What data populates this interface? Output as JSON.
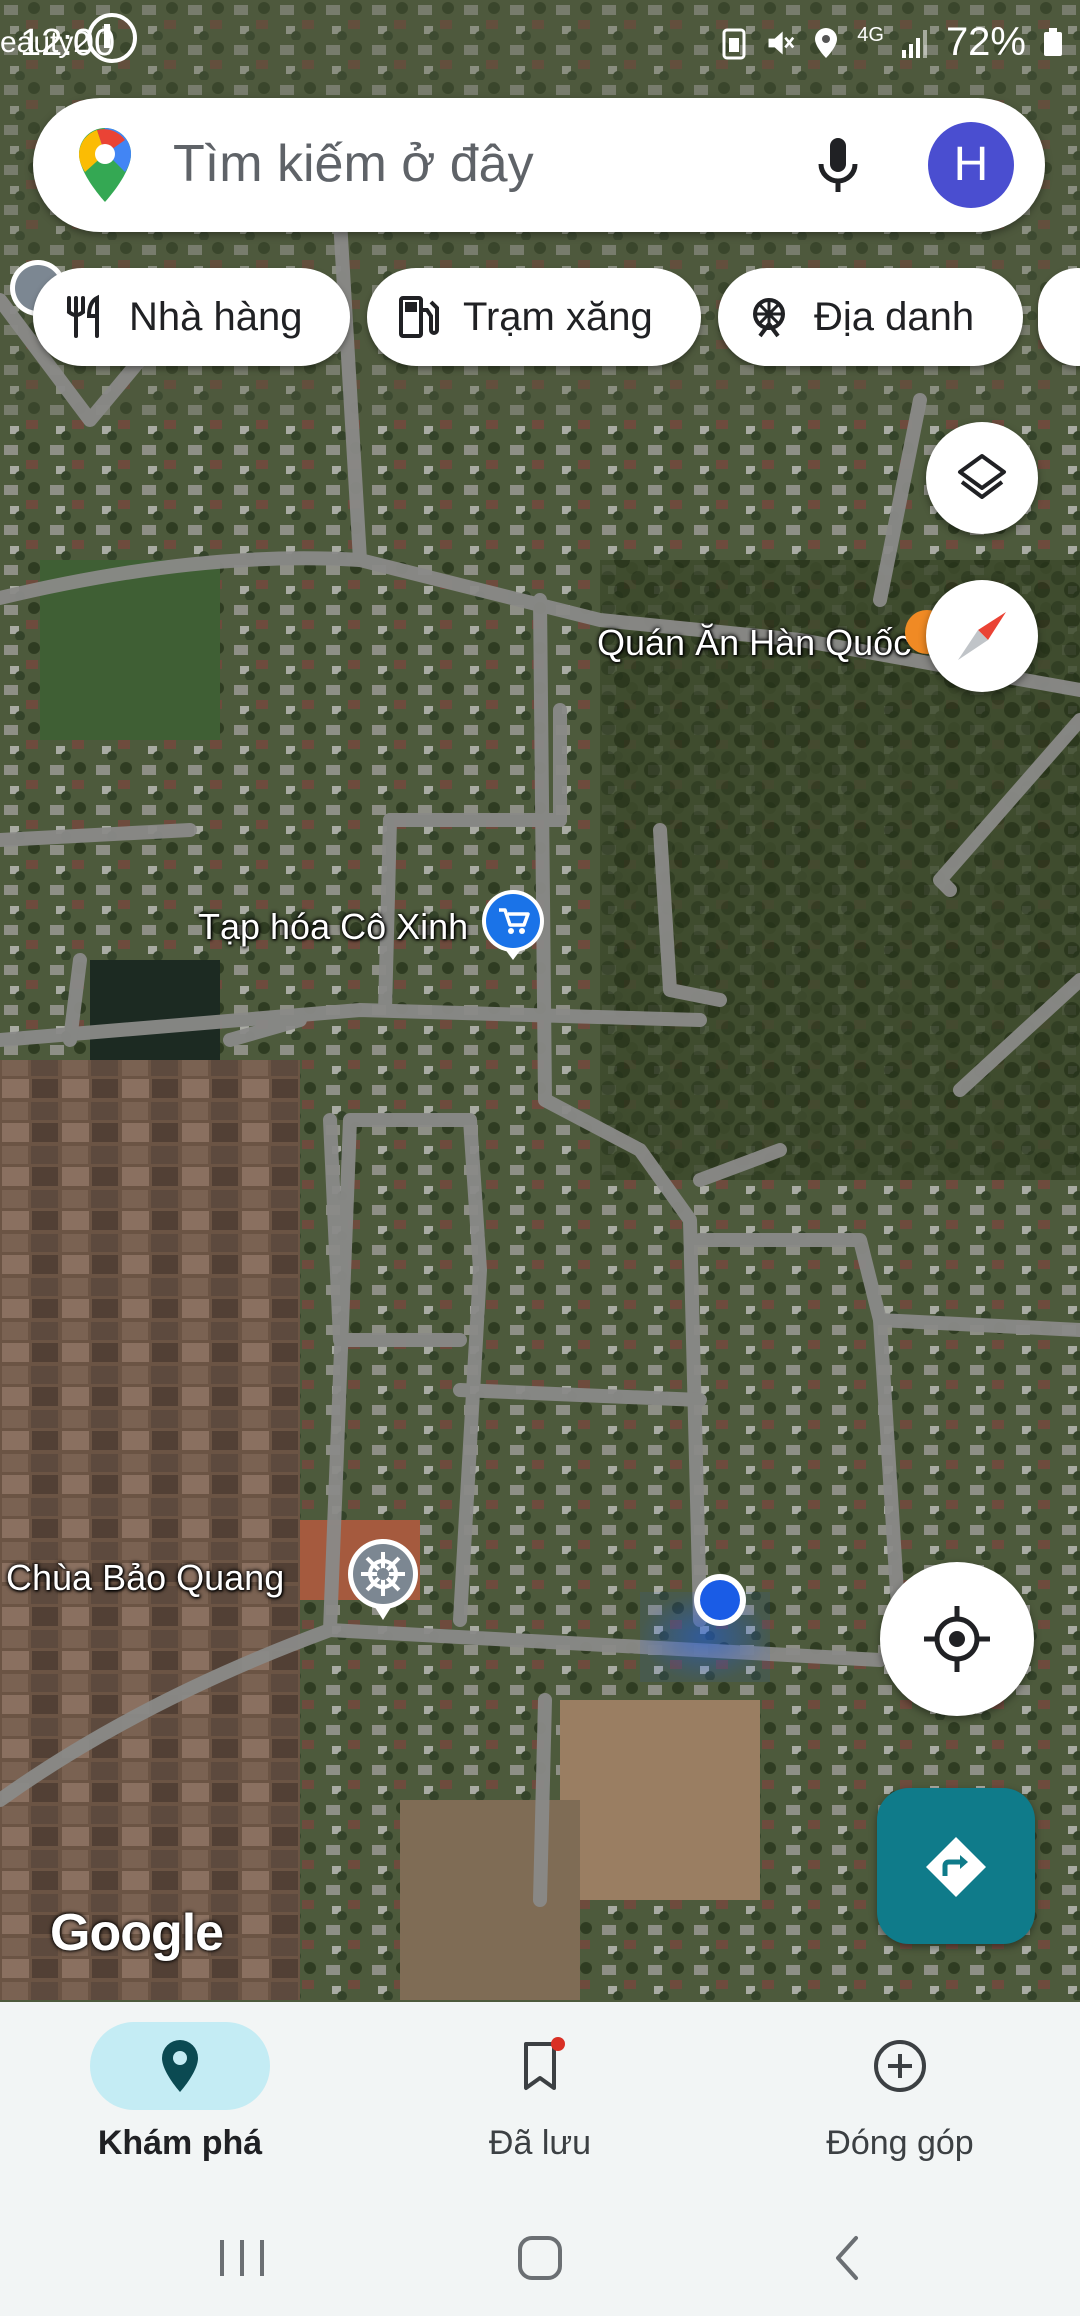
{
  "status_bar": {
    "time": "12:00",
    "notification_text": "eauty2",
    "network": "4G",
    "battery": "72%"
  },
  "search": {
    "placeholder": "Tìm kiếm ở đây",
    "avatar_letter": "H"
  },
  "chips": [
    {
      "label": "Nhà hàng",
      "icon": "restaurant-icon"
    },
    {
      "label": "Trạm xăng",
      "icon": "gas-station-icon"
    },
    {
      "label": "Địa danh",
      "icon": "landmark-icon"
    }
  ],
  "map_labels": {
    "korean_restaurant": "Quán Ăn Hàn Quốc",
    "grocery": "Tạp hóa Cô Xinh",
    "pagoda": "Chùa Bảo Quang"
  },
  "map_attribution": "Google",
  "bottom_nav": [
    {
      "label": "Khám phá",
      "icon": "explore-pin-icon",
      "active": true
    },
    {
      "label": "Đã lưu",
      "icon": "bookmark-icon",
      "active": false
    },
    {
      "label": "Đóng góp",
      "icon": "add-circle-icon",
      "active": false
    }
  ],
  "colors": {
    "accent_teal": "#0f7b8a",
    "active_nav_bg": "#c4ecf4",
    "avatar_bg": "#4a4ed0",
    "location_blue": "#1a5ce6"
  }
}
